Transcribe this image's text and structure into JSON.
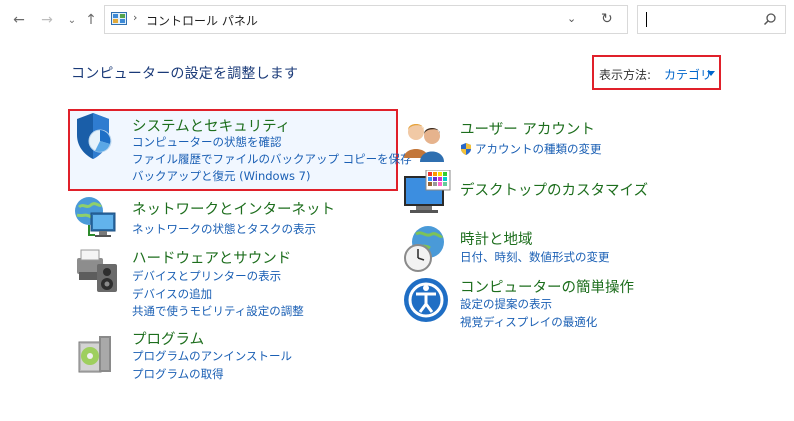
{
  "nav": {
    "address_path": "コントロール パネル",
    "address_separator": "›"
  },
  "header": {
    "title": "コンピューターの設定を調整します",
    "view_by_label": "表示方法:",
    "view_by_value": "カテゴリ"
  },
  "left_categories": [
    {
      "title": "システムとセキュリティ",
      "links": [
        "コンピューターの状態を確認",
        "ファイル履歴でファイルのバックアップ コピーを保存",
        "バックアップと復元 (Windows 7)"
      ]
    },
    {
      "title": "ネットワークとインターネット",
      "links": [
        "ネットワークの状態とタスクの表示"
      ]
    },
    {
      "title": "ハードウェアとサウンド",
      "links": [
        "デバイスとプリンターの表示",
        "デバイスの追加",
        "共通で使うモビリティ設定の調整"
      ]
    },
    {
      "title": "プログラム",
      "links": [
        "プログラムのアンインストール",
        "プログラムの取得"
      ]
    }
  ],
  "right_categories": [
    {
      "title": "ユーザー アカウント",
      "links": [
        "アカウントの種類の変更"
      ]
    },
    {
      "title": "デスクトップのカスタマイズ",
      "links": []
    },
    {
      "title": "時計と地域",
      "links": [
        "日付、時刻、数値形式の変更"
      ]
    },
    {
      "title": "コンピューターの簡単操作",
      "links": [
        "設定の提案の表示",
        "視覚ディスプレイの最適化"
      ]
    }
  ],
  "colors": {
    "title_green": "#1d6e1d",
    "link_blue": "#1a5fb4",
    "highlight_red": "#e0202a"
  }
}
